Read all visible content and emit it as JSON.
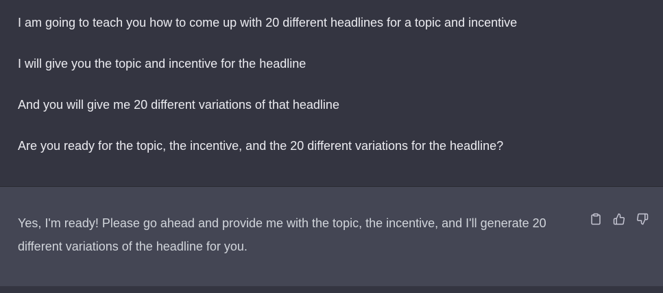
{
  "conversation": {
    "user_message": {
      "lines": [
        "I am going to teach you how to come up with 20 different headlines for a topic and incentive",
        "I will give you the topic and incentive for the headline",
        "And you will give me 20 different variations of that headline",
        "Are you ready for the topic, the incentive, and the 20 different variations for the headline?"
      ]
    },
    "assistant_message": {
      "text": "Yes, I'm ready! Please go ahead and provide me with the topic, the incentive, and I'll generate 20 different variations of the headline for you.",
      "actions": [
        {
          "icon": "clipboard-icon"
        },
        {
          "icon": "thumbs-up-icon"
        },
        {
          "icon": "thumbs-down-icon"
        }
      ]
    }
  },
  "colors": {
    "user_bg": "#343541",
    "assistant_bg": "#444654",
    "user_text": "#ececf1",
    "assistant_text": "#d1d5db",
    "icon": "#c5c5d2"
  }
}
